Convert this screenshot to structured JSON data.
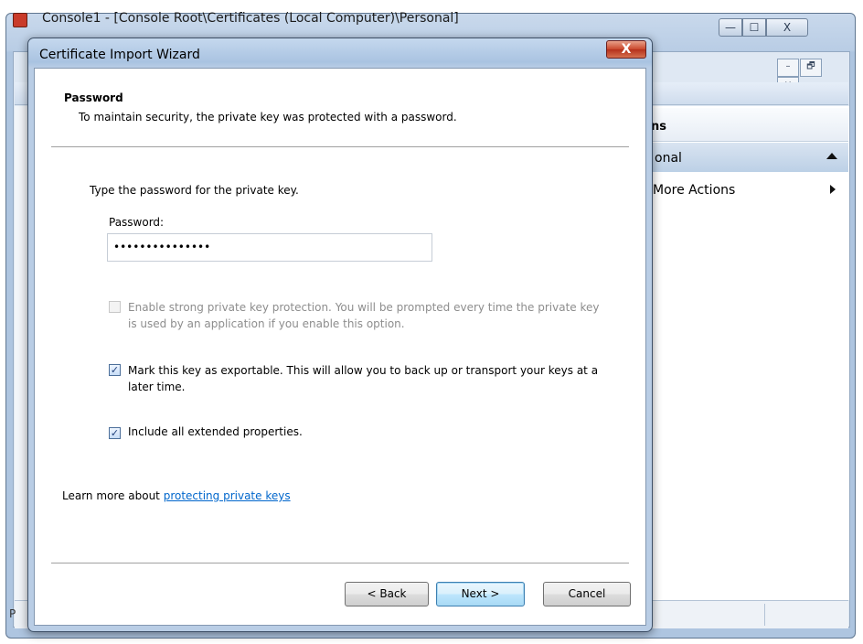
{
  "background_window": {
    "title": "Console1 - [Console Root\\Certificates (Local Computer)\\Personal]",
    "caption_buttons": {
      "minimize": "—",
      "maximize": "☐",
      "close": "X"
    },
    "inner_controls": {
      "minimize": "–",
      "restore": "🗗",
      "close": "×"
    },
    "actions_pane": {
      "header": "ns",
      "subheader": "onal",
      "more_actions": "More Actions"
    },
    "status_text": "P"
  },
  "dialog": {
    "title": "Certificate Import Wizard",
    "close_label": "X",
    "page_heading": "Password",
    "page_subheading": "To maintain security, the private key was protected with a password.",
    "instruction": "Type the password for the private key.",
    "password_label": "Password:",
    "password_value": "•••••••••••••••",
    "checkboxes": {
      "strong_protection": {
        "label": "Enable strong private key protection. You will be prompted every time the private key is used by an application if you enable this option.",
        "checked": false,
        "enabled": false
      },
      "exportable": {
        "label": "Mark this key as exportable. This will allow you to back up or transport your keys at a later time.",
        "checked": true
      },
      "extended_properties": {
        "label": "Include all extended properties.",
        "checked": true
      }
    },
    "learn_more_prefix": "Learn more about ",
    "learn_more_link": "protecting private keys",
    "buttons": {
      "back": "< Back",
      "next": "Next >",
      "cancel": "Cancel"
    },
    "check_mark": "✓"
  },
  "colors": {
    "link": "#0066cc",
    "close_button": "#c9462b",
    "disabled_text": "#8d8d8d"
  }
}
